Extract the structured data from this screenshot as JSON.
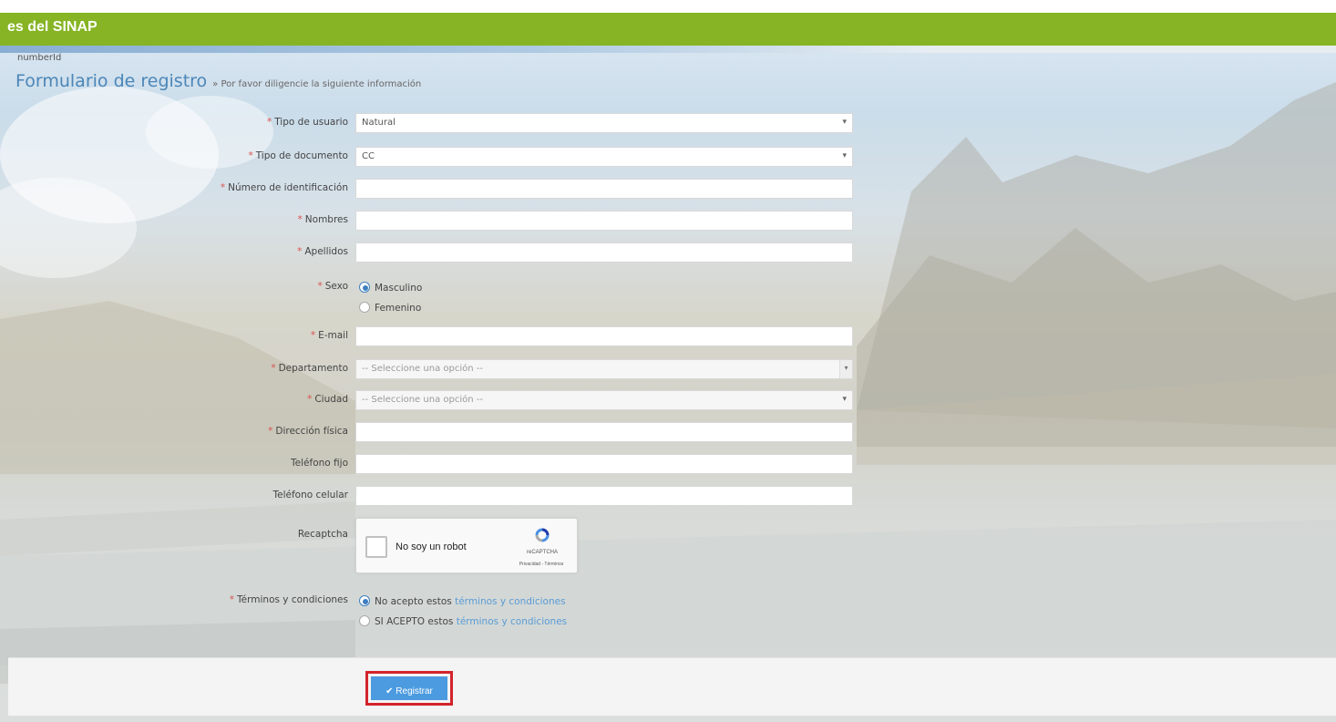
{
  "header": {
    "title": "es del SINAP"
  },
  "breadcrumb": "numberId",
  "page": {
    "title": "Formulario de registro",
    "subtitle": "» Por favor diligencie la siguiente información"
  },
  "form": {
    "required_mark": "*",
    "tipo_usuario": {
      "label": "Tipo de usuario",
      "value": "Natural"
    },
    "tipo_documento": {
      "label": "Tipo de documento",
      "value": "CC"
    },
    "numero_identificacion": {
      "label": "Número de identificación",
      "value": ""
    },
    "nombres": {
      "label": "Nombres",
      "value": ""
    },
    "apellidos": {
      "label": "Apellidos",
      "value": ""
    },
    "sexo": {
      "label": "Sexo",
      "options": [
        "Masculino",
        "Femenino"
      ],
      "selected": "Masculino"
    },
    "email": {
      "label": "E-mail",
      "value": ""
    },
    "departamento": {
      "label": "Departamento",
      "placeholder": "-- Seleccione una opción --"
    },
    "ciudad": {
      "label": "Ciudad",
      "placeholder": "-- Seleccione una opción --"
    },
    "direccion": {
      "label": "Dirección física",
      "value": ""
    },
    "telefono_fijo": {
      "label": "Teléfono fijo",
      "value": ""
    },
    "telefono_celular": {
      "label": "Teléfono celular",
      "value": ""
    },
    "recaptcha": {
      "label": "Recaptcha",
      "text": "No soy un robot",
      "brand": "reCAPTCHA",
      "links": "Privacidad - Términos"
    },
    "terminos": {
      "label": "Términos y condiciones",
      "no_text": "No acepto estos ",
      "si_text": "SI ACEPTO estos ",
      "link_text": "términos y condiciones",
      "selected": "no"
    }
  },
  "actions": {
    "register_label": "Registrar"
  },
  "colors": {
    "header": "#86b424",
    "accent": "#4c9be0",
    "highlight": "#d3242c",
    "link": "#5b9bd5"
  }
}
